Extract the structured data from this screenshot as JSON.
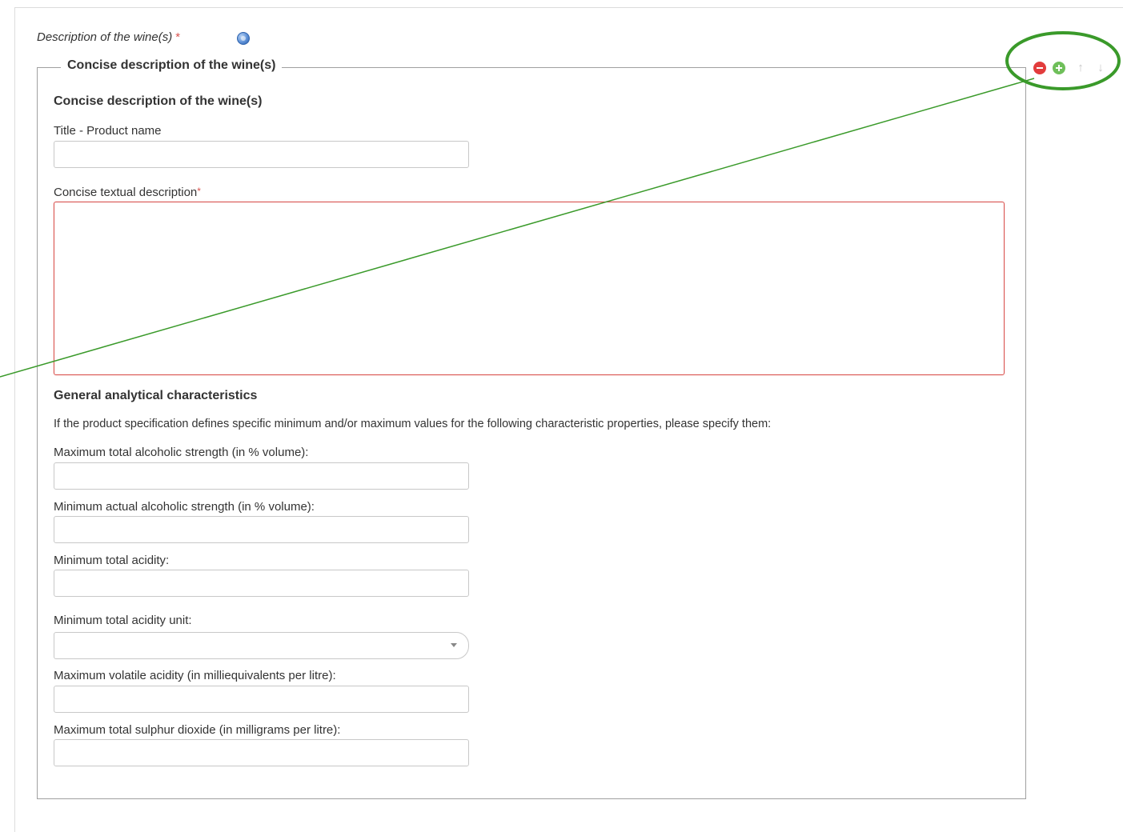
{
  "section": {
    "label": "Description of the wine(s)",
    "required_mark": "*"
  },
  "fieldset": {
    "legend": "Concise description of the wine(s)",
    "heading": "Concise description of the wine(s)",
    "title_label": "Title - Product name",
    "title_value": "",
    "description_label": "Concise textual description",
    "description_required_mark": "*",
    "description_value": "",
    "analytical_heading": "General analytical characteristics",
    "analytical_intro": "If the product specification defines specific minimum and/or maximum values for the following characteristic properties, please specify them:",
    "fields": {
      "max_total_alcoholic_label": "Maximum total alcoholic strength (in % volume):",
      "min_actual_alcoholic_label": "Minimum actual alcoholic strength (in % volume):",
      "min_total_acidity_label": "Minimum total acidity:",
      "min_total_acidity_unit_label": "Minimum total acidity unit:",
      "min_total_acidity_unit_value": "",
      "max_volatile_acidity_label": "Maximum volatile acidity (in milliequivalents per litre):",
      "max_total_sulphur_label": "Maximum total sulphur dioxide (in milligrams per litre):"
    }
  },
  "controls": {
    "remove_icon": "minus-circle-icon",
    "add_icon": "plus-circle-icon",
    "move_up_icon": "arrow-up-icon",
    "move_down_icon": "arrow-down-icon",
    "move_up_glyph": "↑",
    "move_down_glyph": "↓"
  },
  "colors": {
    "required": "#d9534f",
    "invalid_border": "#d9534f",
    "annotation": "#3a9a2a",
    "remove": "#e23c3c",
    "add": "#6fbf5a",
    "help": "#5c8fd6"
  }
}
